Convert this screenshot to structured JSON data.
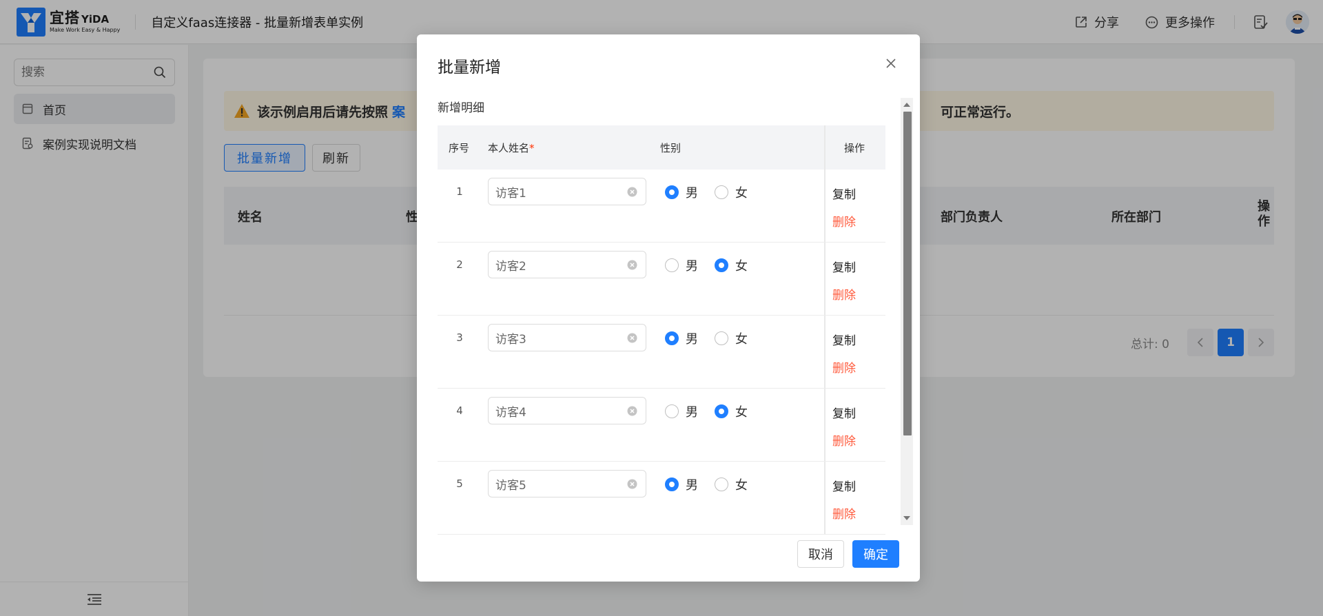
{
  "brand": {
    "name": "宜搭",
    "name_en": "YiDA",
    "slogan": "Make Work Easy & Happy",
    "color": "#1f7fff"
  },
  "header": {
    "title": "自定义faas连接器 - 批量新增表单实例",
    "share_label": "分享",
    "share_icon": "share-icon",
    "more_label": "更多操作",
    "more_icon": "more-icon"
  },
  "sidebar": {
    "search_placeholder": "搜索",
    "items": [
      {
        "label": "首页",
        "icon": "page-icon",
        "active": true
      },
      {
        "label": "案例实现说明文档",
        "icon": "document-icon",
        "active": false
      }
    ]
  },
  "main": {
    "warning_prefix": "该示例启用后请先按照",
    "warning_link": "案",
    "warning_suffix": "可正常运行。",
    "batch_add_label": "批量新增",
    "refresh_label": "刷新",
    "columns": [
      "姓名",
      "性",
      "部门负责人",
      "所在部门",
      "操作"
    ],
    "pager": {
      "total_label": "总计: 0",
      "current_page": "1"
    }
  },
  "modal": {
    "title": "批量新增",
    "section_label": "新增明细",
    "columns": {
      "seq": "序号",
      "name": "本人姓名",
      "required_mark": "*",
      "gender": "性别",
      "ops": "操作"
    },
    "gender_options": {
      "male": "男",
      "female": "女"
    },
    "copy_label": "复制",
    "delete_label": "删除",
    "rows": [
      {
        "seq": "1",
        "name": "访客1",
        "gender": "male"
      },
      {
        "seq": "2",
        "name": "访客2",
        "gender": "female"
      },
      {
        "seq": "3",
        "name": "访客3",
        "gender": "male"
      },
      {
        "seq": "4",
        "name": "访客4",
        "gender": "female"
      },
      {
        "seq": "5",
        "name": "访客5",
        "gender": "male"
      }
    ],
    "cancel_label": "取消",
    "ok_label": "确定"
  }
}
